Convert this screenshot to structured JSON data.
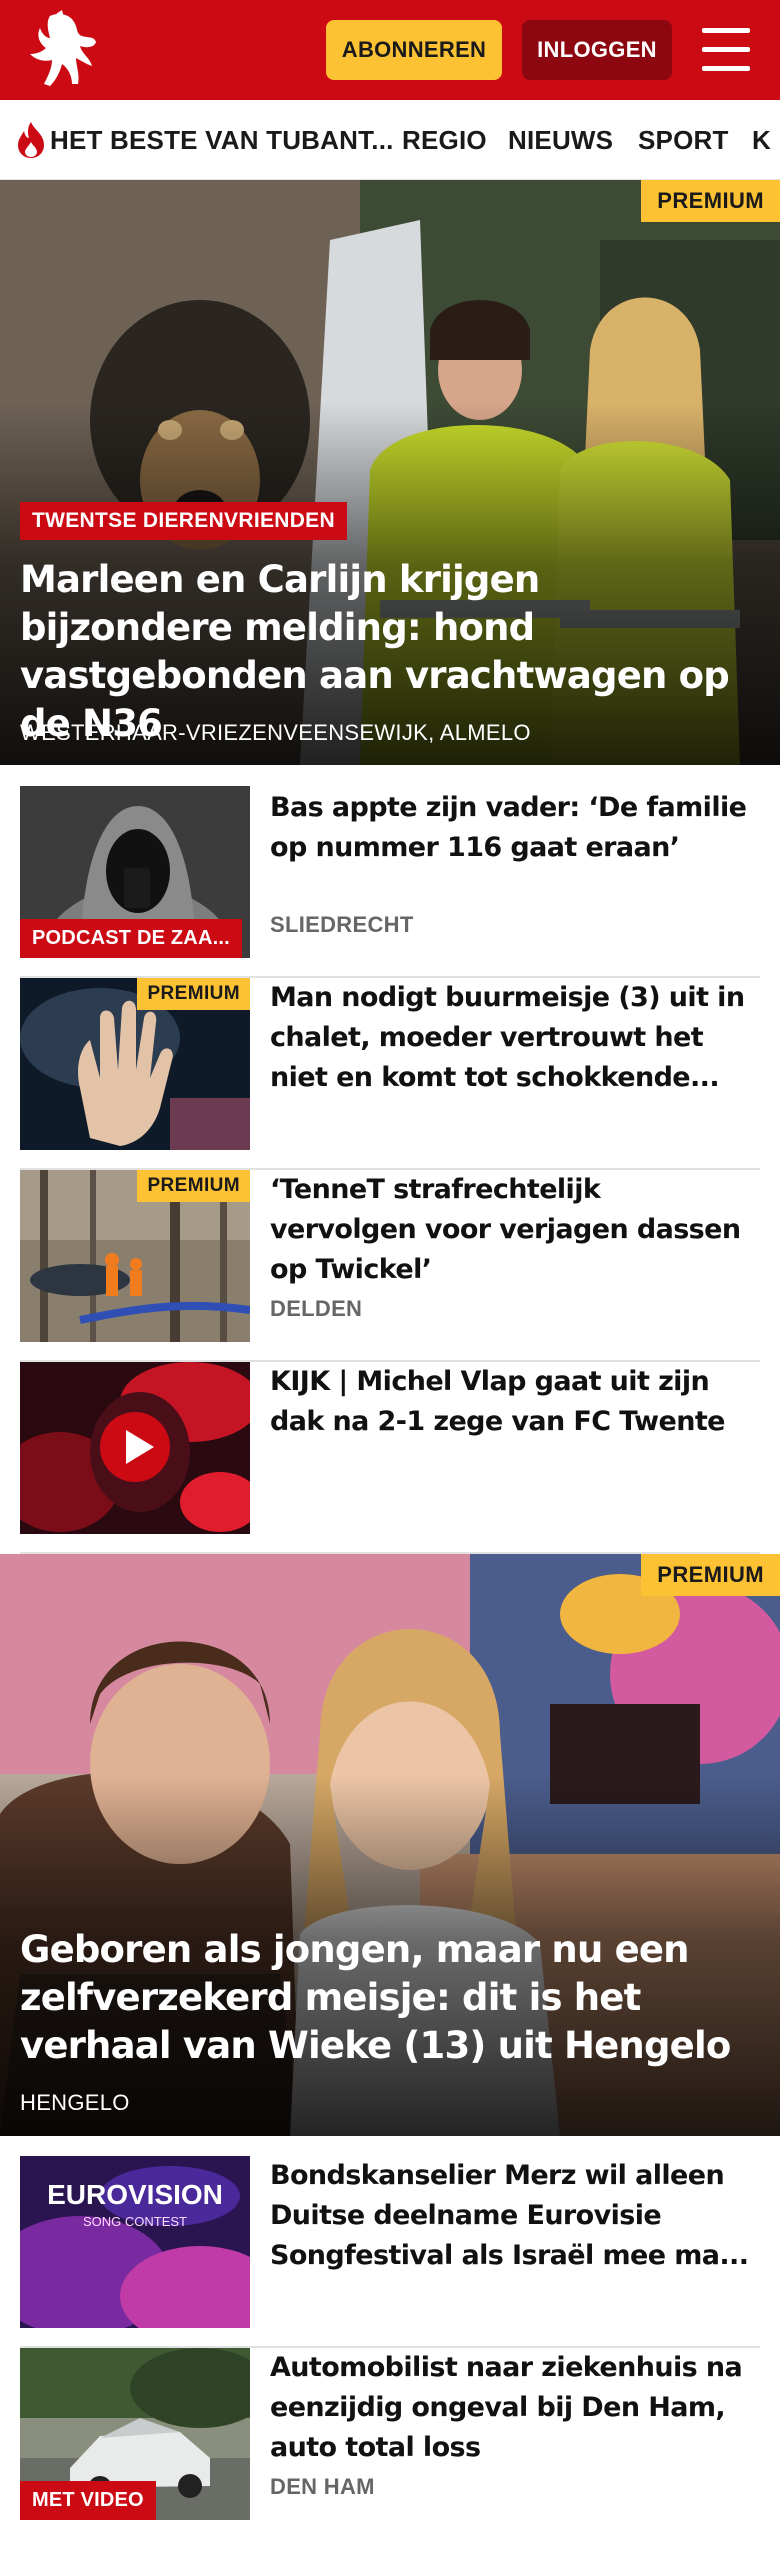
{
  "header": {
    "subscribe_label": "ABONNEREN",
    "login_label": "INLOGGEN"
  },
  "nav": {
    "items": [
      "HET BESTE VAN TUBANT...",
      "REGIO",
      "NIEUWS",
      "SPORT",
      "K"
    ]
  },
  "colors": {
    "brand_red": "#cc0a14",
    "subscribe_yellow": "#fcc233",
    "login_dark_red": "#8c0710"
  },
  "icons": [
    "tubantia-horse-logo",
    "menu-icon",
    "flame-icon",
    "play-icon"
  ],
  "articles": {
    "hero1": {
      "premium": "PREMIUM",
      "tag": "TWENTSE DIERENVRIENDEN",
      "title": "Marleen en Carlijn krijgen bijzondere melding: hond vastgebonden aan vrachtwagen op de N36",
      "location": "WESTERHAAR-VRIEZENVEENSEWIJK, ALMELO"
    },
    "item1": {
      "badge": "PODCAST DE ZAA...",
      "title": "Bas appte zijn vader: ‘De familie op nummer 116 gaat eraan’",
      "location": "SLIEDRECHT"
    },
    "item2": {
      "premium": "PREMIUM",
      "title": "Man nodigt buurmeisje (3) uit in chalet, moeder vertrouwt het niet en komt tot schokkende..."
    },
    "item3": {
      "premium": "PREMIUM",
      "title": "‘TenneT strafrechtelijk vervolgen voor verjagen dassen op Twickel’",
      "location": "DELDEN"
    },
    "item4": {
      "title": "KIJK | Michel Vlap gaat uit zijn dak na 2-1 zege van FC Twente"
    },
    "hero2": {
      "premium": "PREMIUM",
      "title": "Geboren als jongen, maar nu een zelfverzekerd meisje: dit is het verhaal van Wieke (13) uit Hengelo",
      "location": "HENGELO"
    },
    "item5": {
      "thumb_text_1": "EUROVISION",
      "thumb_text_2": "SONG CONTEST",
      "title": "Bondskanselier Merz wil alleen Duitse deelname Eurovisie Songfestival als Israël mee ma..."
    },
    "item6": {
      "badge": "MET VIDEO",
      "title": "Automobilist naar ziekenhuis na eenzijdig ongeval bij Den Ham, auto total loss",
      "location": "DEN HAM"
    }
  }
}
